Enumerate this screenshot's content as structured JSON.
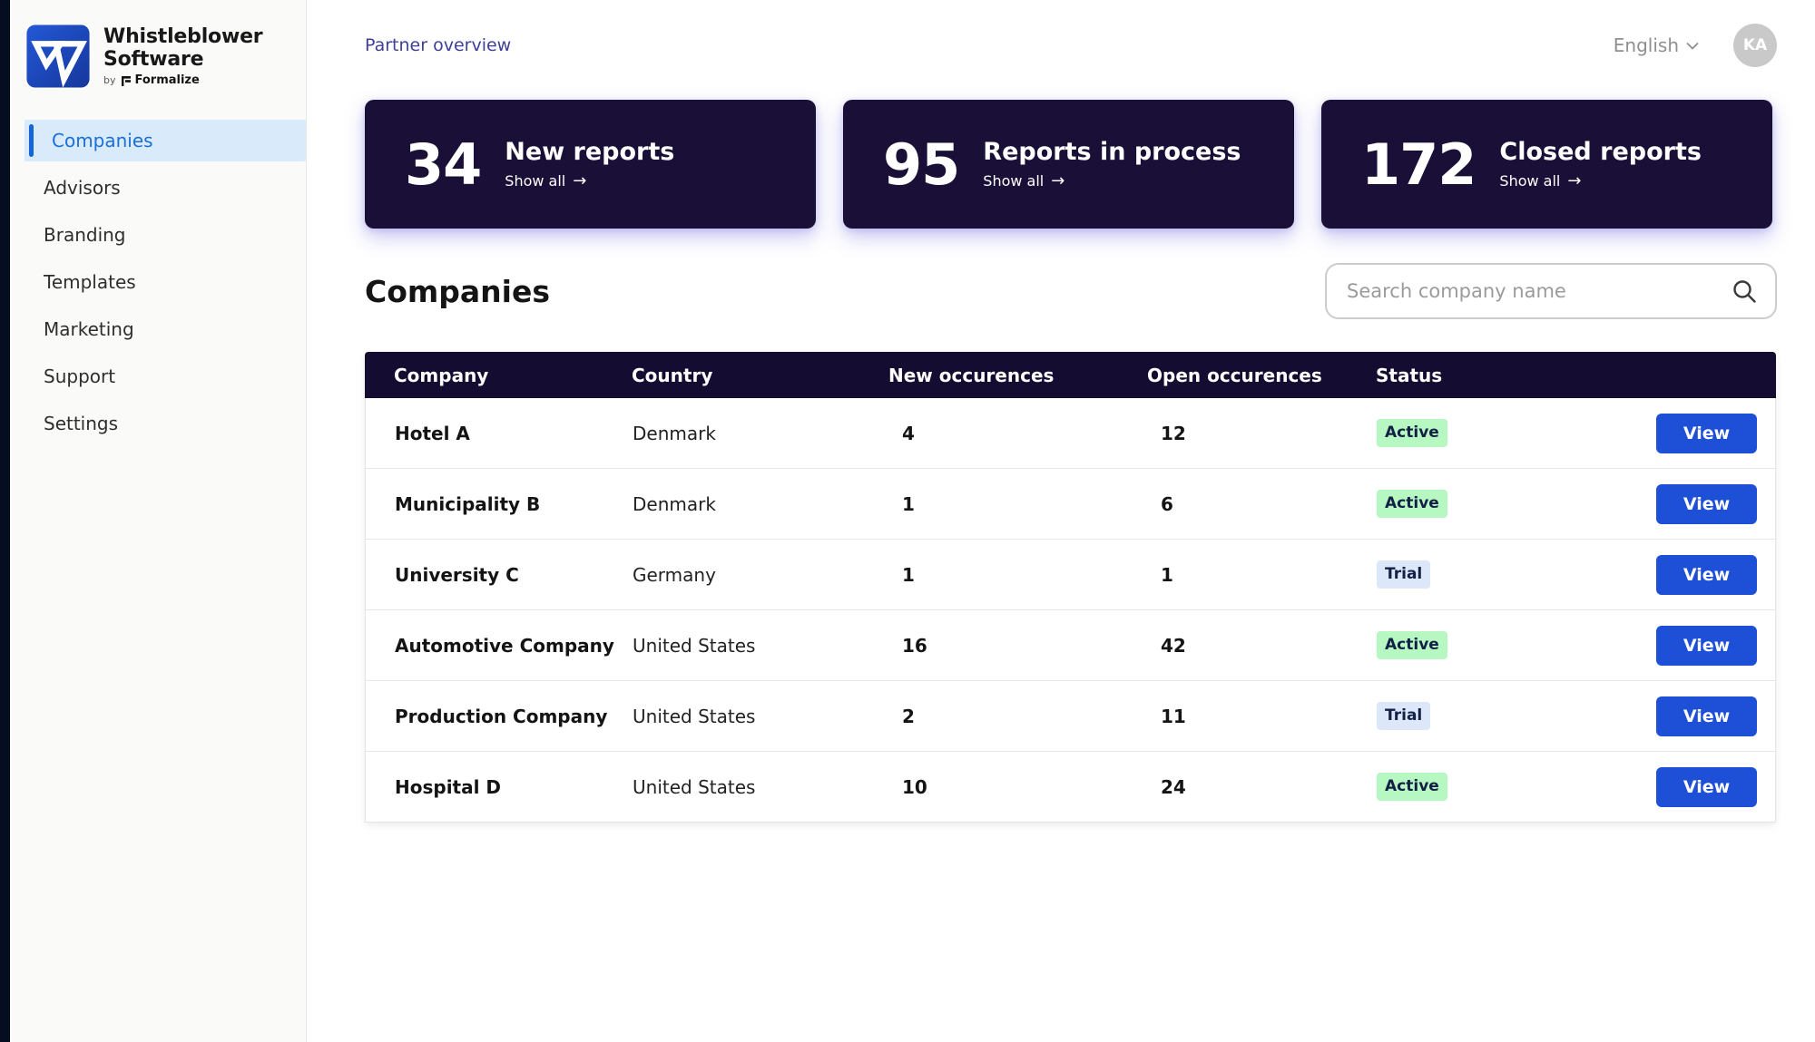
{
  "brand": {
    "title_line1": "Whistleblower",
    "title_line2": "Software",
    "byline_prefix": "by",
    "byline_brand": "Formalize"
  },
  "sidebar": {
    "items": [
      {
        "label": "Companies",
        "active": true
      },
      {
        "label": "Advisors",
        "active": false
      },
      {
        "label": "Branding",
        "active": false
      },
      {
        "label": "Templates",
        "active": false
      },
      {
        "label": "Marketing",
        "active": false
      },
      {
        "label": "Support",
        "active": false
      },
      {
        "label": "Settings",
        "active": false
      }
    ]
  },
  "topbar": {
    "breadcrumb": "Partner overview",
    "language": "English",
    "avatar_initials": "KA"
  },
  "stats": {
    "cards": [
      {
        "value": "34",
        "label": "New reports",
        "link": "Show all"
      },
      {
        "value": "95",
        "label": "Reports in process",
        "link": "Show all"
      },
      {
        "value": "172",
        "label": "Closed reports",
        "link": "Show all"
      }
    ]
  },
  "companies": {
    "heading": "Companies",
    "search_placeholder": "Search company name"
  },
  "table": {
    "columns": [
      "Company",
      "Country",
      "New occurences",
      "Open occurences",
      "Status"
    ],
    "rows": [
      {
        "company": "Hotel A",
        "country": "Denmark",
        "new": "4",
        "open": "12",
        "status": "Active",
        "action": "View"
      },
      {
        "company": "Municipality B",
        "country": "Denmark",
        "new": "1",
        "open": "6",
        "status": "Active",
        "action": "View"
      },
      {
        "company": "University C",
        "country": "Germany",
        "new": "1",
        "open": "1",
        "status": "Trial",
        "action": "View"
      },
      {
        "company": "Automotive Company",
        "country": "United States",
        "new": "16",
        "open": "42",
        "status": "Active",
        "action": "View"
      },
      {
        "company": "Production Company",
        "country": "United States",
        "new": "2",
        "open": "11",
        "status": "Trial",
        "action": "View"
      },
      {
        "company": "Hospital D",
        "country": "United States",
        "new": "10",
        "open": "24",
        "status": "Active",
        "action": "View"
      }
    ]
  },
  "colors": {
    "dark_navy_card": "#1a1037",
    "table_header": "#150c31",
    "primary_blue": "#1d4fd7",
    "active_nav_bg": "#d9eafb",
    "active_nav_text": "#1b6fd8",
    "badge_active_bg": "#b7f7c1",
    "badge_trial_bg": "#dce8fa",
    "breadcrumb_indigo": "#3d3f99"
  }
}
